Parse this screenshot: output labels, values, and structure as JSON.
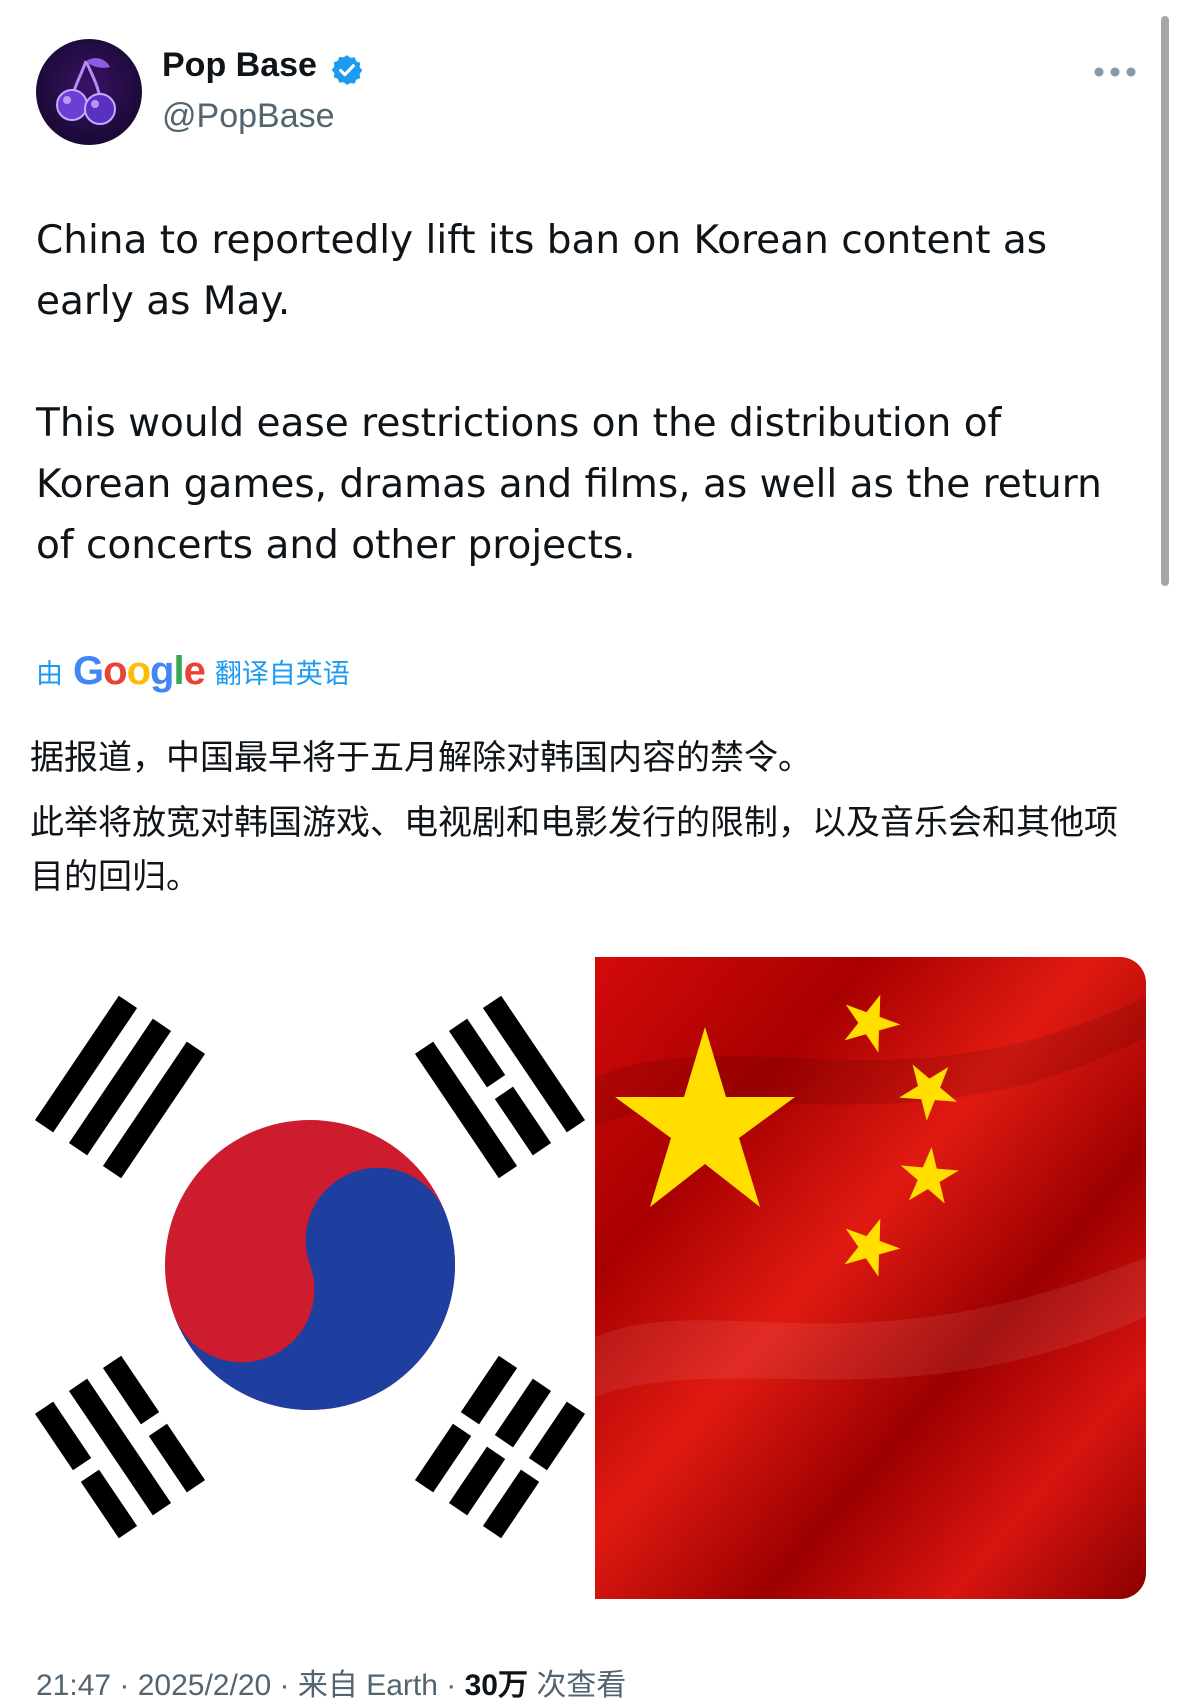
{
  "author": {
    "display_name": "Pop Base",
    "handle": "@PopBase",
    "verified": true,
    "avatar_icon": "cherries-icon"
  },
  "menu": {
    "icon": "more-options-icon"
  },
  "tweet": {
    "paragraphs": [
      "China to reportedly lift its ban on Korean content as early as May.",
      "This would ease restrictions on the distribution of Korean games, dramas and films, as well as the return of concerts and other projects."
    ]
  },
  "translation": {
    "by_label": "由",
    "provider": [
      "G",
      "o",
      "o",
      "g",
      "l",
      "e"
    ],
    "provider_colors": [
      "#4285f4",
      "#ea4335",
      "#fbbc05",
      "#4285f4",
      "#34a853",
      "#ea4335"
    ],
    "from_label": "翻译自英语",
    "paragraphs": [
      "据报道，中国最早将于五月解除对韩国内容的禁令。",
      "此举将放宽对韩国游戏、电视剧和电影发行的限制，以及音乐会和其他项目的回归。"
    ]
  },
  "media": {
    "images": [
      "south-korea-flag",
      "china-flag"
    ]
  },
  "footer": {
    "timestamp": "21:47 · 2025/2/20",
    "source": "来自 Earth",
    "views_count": "30万",
    "views_label": "次查看"
  },
  "colors": {
    "link_blue": "#1d9bf0",
    "text_primary": "#0f1419",
    "text_secondary": "#536471"
  }
}
